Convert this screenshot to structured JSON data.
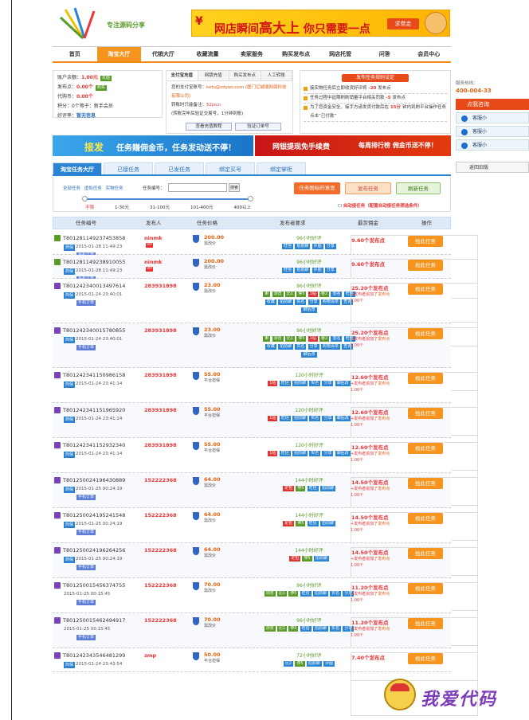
{
  "header": {
    "logo_tag": "专注源码分享",
    "banner": {
      "yen": "¥",
      "text_pre": "网店瞬间",
      "text_big": "高大上",
      "text_post": " 你只需要一点",
      "button": "求带走"
    }
  },
  "nav": {
    "items": [
      "首页",
      "淘宝大厅",
      "代销大厅",
      "收藏流量",
      "卖家服务",
      "购买发布点",
      "网店托管",
      "问答",
      "会员中心"
    ],
    "active": 1
  },
  "account": {
    "balance_label": "账户余额：",
    "balance": "1.00元",
    "balance_btn": "充值",
    "points_label": "发布点：",
    "points": "0.00个",
    "points_btn": "购买",
    "agent_label": "代购币：",
    "agent": "0.00个",
    "score_label": "积分：",
    "score": "0个等于：新手会员",
    "rate_label": "好评率：",
    "rate": "暂无信息"
  },
  "pay_panel": {
    "tabs": [
      "支付宝充值",
      "网银充值",
      "购买发布点",
      "人工转账"
    ],
    "line1_label": "您的支付宝账号：",
    "line1_value": "kefu@zdyao.com",
    "line1_org": "(厦门亿城顺网络科技有限公司)",
    "line2_label": "转账时只能备注：",
    "line2_value": "52jscn",
    "line3": "(转账完毕后验证交易号，1分钟到账)",
    "btn1": "查看充值教程",
    "btn2": "验证订单号"
  },
  "notice": {
    "title": "发布任务规则设定",
    "rows": [
      {
        "pre": "接实物任务后立即收货好评将",
        "val": "-20",
        "post": "发布点"
      },
      {
        "pre": "任务过程中延期刷刷销量平台相关罚款",
        "val": "-5",
        "post": "发布点"
      },
      {
        "pre": "为了您资金安全，接手方请发货付款后在",
        "val": "15分",
        "post": "钟内到刷平台操作任务点击“已付款”"
      }
    ]
  },
  "sidebar": {
    "hotline_label": "服务热线：",
    "hotline": "400-004-33",
    "click_label": "点我咨询",
    "service": [
      "客服小",
      "客服小",
      "客服小"
    ],
    "back_label": "返回旧版"
  },
  "ads": {
    "left_a": "接发",
    "left_b": "任务赚佣金币，任务发动送不停！",
    "right_a": "网银提现免手续费",
    "right_b": "每周排行榜 佣金币送不停！"
  },
  "task_tabs": {
    "items": [
      "淘宝任务大厅",
      "已接任务",
      "已发任务",
      "绑定买号",
      "绑定掌柜"
    ],
    "active": 0
  },
  "filter": {
    "types": "全部任务 虚拟任务 实物任务",
    "search_label": "任务编号：",
    "search_button": "搜索",
    "price_levels": [
      "不限",
      "1-30元",
      "31-100元",
      "101-400元",
      "400以上"
    ],
    "btn_icon": "任务图标的意思",
    "btn_publish": "发布任务",
    "btn_refresh": "刷新任务",
    "auto_label": "自动接任务",
    "auto_note": "（配置自动接任务筛选条件）"
  },
  "table": {
    "headers": [
      "任务编号",
      "发布人",
      "任务价格",
      "发布者要求",
      "最赏佣金",
      "操作"
    ],
    "action_label": "抢此任务",
    "rows": [
      {
        "id": "T801281149237453858",
        "icon": "g",
        "tag": "商保",
        "date": "2015-01-28 11:49:23",
        "mobile": "手机订单",
        "pub": "ninmk",
        "vip": "VIP",
        "price": "200.00",
        "ptype": "需改价",
        "req": "96小时好评",
        "tags": [
          [
            "旺信",
            ""
          ],
          [
            "拍前聊",
            ""
          ],
          [
            "评图",
            ""
          ],
          [
            "分享",
            ""
          ]
        ],
        "pay": "9.60个发布点",
        "extra": []
      },
      {
        "id": "T801281149238910055",
        "icon": "g",
        "tag": "商保",
        "date": "2015-01-28 11:49:23",
        "mobile": "手机订单",
        "pub": "ninmk",
        "vip": "VIP",
        "price": "200.00",
        "ptype": "需改价",
        "req": "96小时好评",
        "tags": [
          [
            "旺信",
            ""
          ],
          [
            "拍前聊",
            ""
          ],
          [
            "评图",
            ""
          ],
          [
            "分享",
            ""
          ]
        ],
        "pay": "9.60个发布点",
        "extra": []
      },
      {
        "id": "T801242340013497614",
        "icon": "p",
        "tag": "商保",
        "date": "2015-01-24 23:40:01",
        "mobile": "手机订单",
        "pub": "283931898",
        "vip": "",
        "price": "23.00",
        "ptype": "需改价",
        "req": "96小时好评",
        "tags": [
          [
            "审",
            "g"
          ],
          [
            "浏览",
            "g"
          ],
          [
            "比1",
            "g"
          ],
          [
            "停5",
            "g"
          ],
          [
            "1钻",
            "r"
          ],
          [
            "卷2",
            "g"
          ],
          [
            "签名",
            ""
          ],
          [
            "旺信",
            ""
          ],
          [
            "收藏",
            ""
          ],
          [
            "拍前聊",
            ""
          ],
          [
            "实名",
            ""
          ],
          [
            "分享",
            ""
          ],
          [
            "购物清单",
            ""
          ],
          [
            "查询",
            ""
          ],
          [
            "聊后改",
            ""
          ]
        ],
        "pay": "25.20个发布点",
        "extra": [
          [
            "+",
            "发布者追加了",
            "发布点"
          ],
          [
            "",
            "2.00个",
            ""
          ]
        ]
      },
      {
        "id": "T801242340015780855",
        "icon": "p",
        "tag": "商保",
        "date": "2015-01-24 23:40:01",
        "mobile": "手机订单",
        "pub": "283931898",
        "vip": "",
        "price": "23.00",
        "ptype": "需改价",
        "req": "96小时好评",
        "tags": [
          [
            "审",
            "g"
          ],
          [
            "浏览",
            "g"
          ],
          [
            "比1",
            "g"
          ],
          [
            "停5",
            "g"
          ],
          [
            "1钻",
            "r"
          ],
          [
            "卷2",
            "g"
          ],
          [
            "签名",
            ""
          ],
          [
            "旺信",
            ""
          ],
          [
            "收藏",
            ""
          ],
          [
            "拍前聊",
            ""
          ],
          [
            "实名",
            ""
          ],
          [
            "分享",
            ""
          ],
          [
            "购物清单",
            ""
          ],
          [
            "查询",
            ""
          ],
          [
            "聊后改",
            ""
          ]
        ],
        "pay": "25.20个发布点",
        "extra": [
          [
            "+",
            "发布者追加了",
            "发布点"
          ],
          [
            "",
            "2.00个",
            ""
          ]
        ]
      },
      {
        "id": "T801242341150986158",
        "icon": "p",
        "tag": "商保",
        "date": "2015-01-24 23:41:14",
        "mobile": "",
        "pub": "283931898",
        "vip": "",
        "price": "55.00",
        "ptype": "平台担保",
        "req": "120小时好评",
        "tags": [
          [
            "1钻",
            "r"
          ],
          [
            "旺信",
            ""
          ],
          [
            "拍前聊",
            ""
          ],
          [
            "实名",
            ""
          ],
          [
            "分享",
            ""
          ],
          [
            "聊后改",
            ""
          ]
        ],
        "pay": "12.60个发布点",
        "extra": [
          [
            "+",
            "发布者追加了",
            "发布点"
          ],
          [
            "",
            "1.00个",
            ""
          ]
        ]
      },
      {
        "id": "T801242341151965920",
        "icon": "p",
        "tag": "商保",
        "date": "2015-01-24 23:41:14",
        "mobile": "",
        "pub": "283931898",
        "vip": "",
        "price": "55.00",
        "ptype": "平台担保",
        "req": "120小时好评",
        "tags": [
          [
            "1钻",
            "r"
          ],
          [
            "旺信",
            ""
          ],
          [
            "拍前聊",
            ""
          ],
          [
            "实名",
            ""
          ],
          [
            "分享",
            ""
          ],
          [
            "聊后改",
            ""
          ]
        ],
        "pay": "12.60个发布点",
        "extra": [
          [
            "+",
            "发布者追加了",
            "发布点"
          ],
          [
            "",
            "1.00个",
            ""
          ]
        ]
      },
      {
        "id": "T801242341152932340",
        "icon": "p",
        "tag": "商保",
        "date": "2015-01-24 23:41:14",
        "mobile": "",
        "pub": "283931898",
        "vip": "",
        "price": "55.00",
        "ptype": "平台担保",
        "req": "120小时好评",
        "tags": [
          [
            "1钻",
            "r"
          ],
          [
            "旺信",
            ""
          ],
          [
            "拍前聊",
            ""
          ],
          [
            "实名",
            ""
          ],
          [
            "分享",
            ""
          ],
          [
            "聊后改",
            ""
          ]
        ],
        "pay": "12.60个发布点",
        "extra": [
          [
            "+",
            "发布者追加了",
            "发布点"
          ],
          [
            "",
            "1.00个",
            ""
          ]
        ]
      },
      {
        "id": "T801250024196430889",
        "icon": "p",
        "tag": "商保",
        "date": "2015-01-25 00:24:19",
        "mobile": "手机订单",
        "pub": "152222368",
        "vip": "",
        "price": "64.00",
        "ptype": "需改价",
        "req": "144小时好评",
        "tags": [
          [
            "定包",
            "r"
          ],
          [
            "停5",
            "g"
          ],
          [
            "旺信",
            ""
          ],
          [
            "拍前聊",
            ""
          ]
        ],
        "pay": "14.50个发布点",
        "extra": [
          [
            "+",
            "发布者追加了",
            "发布点"
          ],
          [
            "",
            "1.00个",
            ""
          ]
        ]
      },
      {
        "id": "T801250024195241548",
        "icon": "p",
        "tag": "商保",
        "date": "2015-01-25 00:24:19",
        "mobile": "手机订单",
        "pub": "152222368",
        "vip": "",
        "price": "64.00",
        "ptype": "需改价",
        "req": "144小时好评",
        "tags": [
          [
            "定包",
            "r"
          ],
          [
            "停5",
            "g"
          ],
          [
            "旺信",
            ""
          ],
          [
            "拍前聊",
            ""
          ]
        ],
        "pay": "14.50个发布点",
        "extra": [
          [
            "+",
            "发布者追加了",
            "发布点"
          ],
          [
            "",
            "1.00个",
            ""
          ]
        ]
      },
      {
        "id": "T801250024196264256",
        "icon": "p",
        "tag": "商保",
        "date": "2015-01-25 00:24:19",
        "mobile": "手机订单",
        "pub": "152222368",
        "vip": "",
        "price": "64.00",
        "ptype": "需改价",
        "req": "144小时好评",
        "tags": [
          [
            "定包",
            "r"
          ],
          [
            "停5",
            "g"
          ],
          [
            "拍前聊",
            ""
          ]
        ],
        "pay": "14.50个发布点",
        "extra": [
          [
            "+",
            "发布者追加了",
            "发布点"
          ],
          [
            "",
            "1.00个",
            ""
          ]
        ]
      },
      {
        "id": "T801250015456374755",
        "icon": "p",
        "tag": "",
        "date": "2015-01-25 00:15:45",
        "mobile": "手机订单",
        "pub": "152222368",
        "vip": "",
        "price": "70.00",
        "ptype": "需改价",
        "req": "96小时好评",
        "tags": [
          [
            "浏览",
            "g"
          ],
          [
            "比1",
            "g"
          ],
          [
            "停5",
            "g"
          ],
          [
            "旺信",
            ""
          ],
          [
            "拍前聊",
            ""
          ],
          [
            "实名",
            ""
          ],
          [
            "分享",
            ""
          ]
        ],
        "pay": "11.20个发布点",
        "extra": [
          [
            "+",
            "发布者追加了",
            "发布点"
          ],
          [
            "",
            "1.00个",
            ""
          ]
        ]
      },
      {
        "id": "T801250015462494917",
        "icon": "p",
        "tag": "",
        "date": "2015-01-25 00:15:45",
        "mobile": "手机订单",
        "pub": "152222368",
        "vip": "",
        "price": "70.00",
        "ptype": "需改价",
        "req": "96小时好评",
        "tags": [
          [
            "浏览",
            "g"
          ],
          [
            "比1",
            "g"
          ],
          [
            "停5",
            "g"
          ],
          [
            "旺信",
            ""
          ],
          [
            "拍前聊",
            ""
          ],
          [
            "实名",
            ""
          ],
          [
            "分享",
            ""
          ]
        ],
        "pay": "11.20个发布点",
        "extra": [
          [
            "+",
            "发布者追加了",
            "发布点"
          ],
          [
            "",
            "1.00个",
            ""
          ]
        ]
      },
      {
        "id": "T801242343546481299",
        "icon": "p",
        "tag": "商保",
        "date": "2015-01-24 23:43:54",
        "mobile": "",
        "pub": "zmp",
        "vip": "",
        "price": "50.00",
        "ptype": "平台担保",
        "req": "72小时好评",
        "tags": [
          [
            "比2",
            ""
          ],
          [
            "停5",
            "g"
          ],
          [
            "拍前聊",
            ""
          ],
          [
            "评图",
            ""
          ]
        ],
        "pay": "7.40个发布点",
        "extra": []
      }
    ]
  },
  "watermark": "我爱代码",
  "colors": {
    "accent": "#f7941d",
    "blue": "#2a84d3",
    "red": "#e33333",
    "green": "#5a9b2a"
  }
}
